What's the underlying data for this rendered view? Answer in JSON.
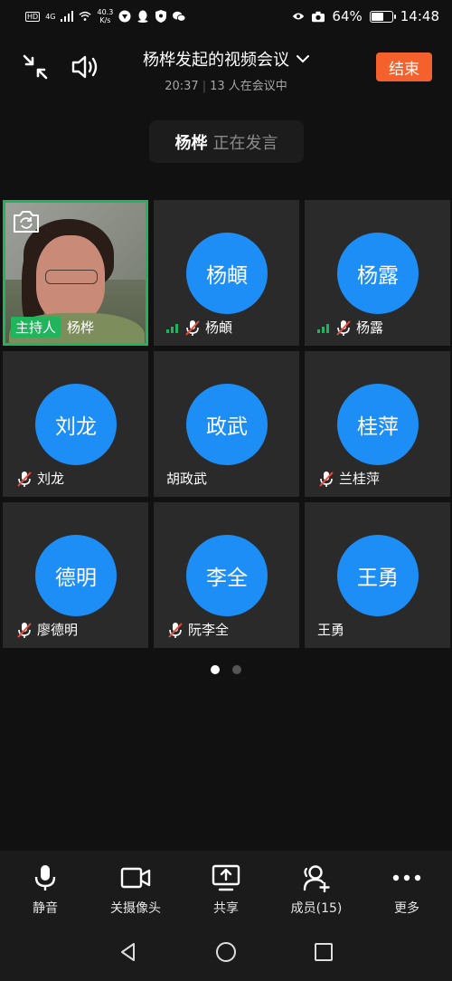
{
  "status_bar": {
    "network": "HD",
    "net_type": "4G",
    "speed_value": "40.3",
    "speed_unit": "K/s",
    "battery": "64%",
    "battery_level": 0.64,
    "time": "14:48"
  },
  "header": {
    "title": "杨桦发起的视频会议",
    "duration": "20:37",
    "participants_text": "13 人在会议中",
    "end_label": "结束"
  },
  "speaking": {
    "name": "杨桦",
    "status": "正在发言"
  },
  "tiles": [
    {
      "avatar": "",
      "name": "杨桦",
      "host_label": "主持人",
      "video": true
    },
    {
      "avatar": "杨頔",
      "name": "杨頔",
      "signal": true,
      "muted": true
    },
    {
      "avatar": "杨露",
      "name": "杨露",
      "signal": true,
      "muted": true
    },
    {
      "avatar": "刘龙",
      "name": "刘龙",
      "muted": true
    },
    {
      "avatar": "政武",
      "name": "胡政武",
      "muted": false
    },
    {
      "avatar": "桂萍",
      "name": "兰桂萍",
      "muted": true
    },
    {
      "avatar": "德明",
      "name": "廖德明",
      "muted": true
    },
    {
      "avatar": "李全",
      "name": "阮李全",
      "muted": true
    },
    {
      "avatar": "王勇",
      "name": "王勇",
      "muted": false
    }
  ],
  "pagination": {
    "current": 1,
    "total": 2
  },
  "toolbar": {
    "mute": "静音",
    "camera": "关摄像头",
    "share": "共享",
    "members": "成员(15)",
    "more": "更多"
  },
  "colors": {
    "accent": "#1c8ef5",
    "end": "#f5612d",
    "host": "#22b35d",
    "mute_slash": "#e94b3c"
  }
}
